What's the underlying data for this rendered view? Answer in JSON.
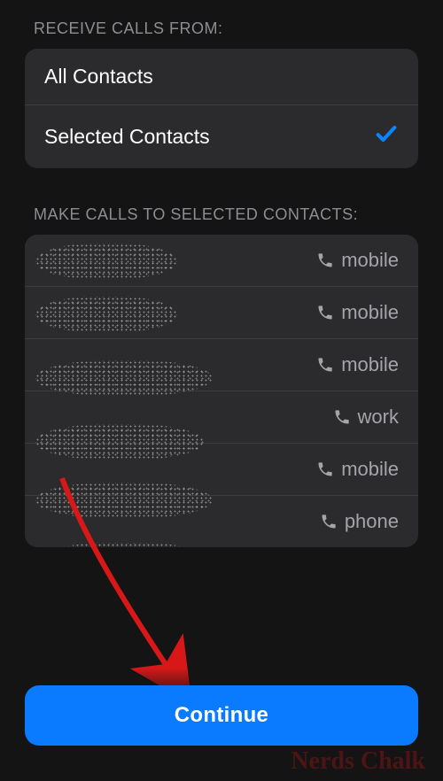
{
  "receive_calls": {
    "header": "RECEIVE CALLS FROM:",
    "options": [
      {
        "label": "All Contacts",
        "selected": false
      },
      {
        "label": "Selected Contacts",
        "selected": true
      }
    ]
  },
  "make_calls": {
    "header": "MAKE CALLS TO SELECTED CONTACTS:",
    "contacts": [
      {
        "name_redacted": true,
        "phone_type": "mobile"
      },
      {
        "name_redacted": true,
        "phone_type": "mobile"
      },
      {
        "name_redacted": true,
        "phone_type": "mobile"
      },
      {
        "name_redacted": true,
        "phone_type": "work"
      },
      {
        "name_redacted": true,
        "phone_type": "mobile"
      },
      {
        "name_redacted": true,
        "phone_type": "phone"
      }
    ]
  },
  "continue_label": "Continue",
  "watermark": "Nerds Chalk",
  "annotation": {
    "arrow_color": "#d81818"
  }
}
